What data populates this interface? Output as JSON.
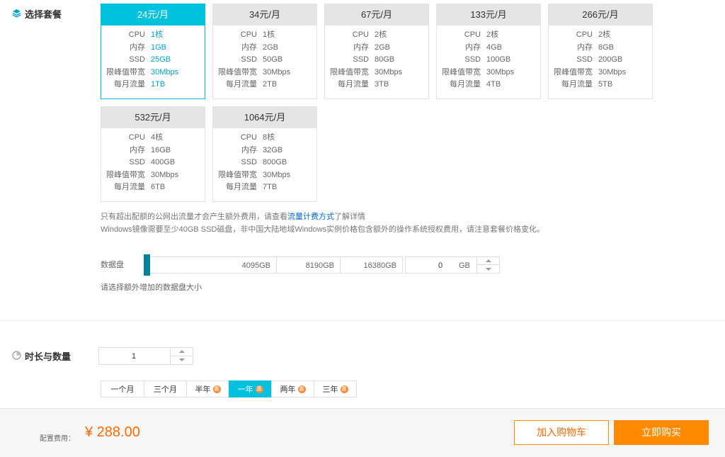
{
  "package_section": {
    "title": "选择套餐",
    "icon": "layers-icon"
  },
  "plans": [
    {
      "price": "24元/月",
      "selected": true,
      "rows": [
        [
          "CPU",
          "1核"
        ],
        [
          "内存",
          "1GB"
        ],
        [
          "SSD",
          "25GB"
        ],
        [
          "限峰值带宽",
          "30Mbps"
        ],
        [
          "每月流量",
          "1TB"
        ]
      ]
    },
    {
      "price": "34元/月",
      "selected": false,
      "rows": [
        [
          "CPU",
          "1核"
        ],
        [
          "内存",
          "2GB"
        ],
        [
          "SSD",
          "50GB"
        ],
        [
          "限峰值带宽",
          "30Mbps"
        ],
        [
          "每月流量",
          "2TB"
        ]
      ]
    },
    {
      "price": "67元/月",
      "selected": false,
      "rows": [
        [
          "CPU",
          "2核"
        ],
        [
          "内存",
          "2GB"
        ],
        [
          "SSD",
          "80GB"
        ],
        [
          "限峰值带宽",
          "30Mbps"
        ],
        [
          "每月流量",
          "3TB"
        ]
      ]
    },
    {
      "price": "133元/月",
      "selected": false,
      "rows": [
        [
          "CPU",
          "2核"
        ],
        [
          "内存",
          "4GB"
        ],
        [
          "SSD",
          "100GB"
        ],
        [
          "限峰值带宽",
          "30Mbps"
        ],
        [
          "每月流量",
          "4TB"
        ]
      ]
    },
    {
      "price": "266元/月",
      "selected": false,
      "rows": [
        [
          "CPU",
          "2核"
        ],
        [
          "内存",
          "8GB"
        ],
        [
          "SSD",
          "200GB"
        ],
        [
          "限峰值带宽",
          "30Mbps"
        ],
        [
          "每月流量",
          "5TB"
        ]
      ]
    },
    {
      "price": "532元/月",
      "selected": false,
      "rows": [
        [
          "CPU",
          "4核"
        ],
        [
          "内存",
          "16GB"
        ],
        [
          "SSD",
          "400GB"
        ],
        [
          "限峰值带宽",
          "30Mbps"
        ],
        [
          "每月流量",
          "6TB"
        ]
      ]
    },
    {
      "price": "1064元/月",
      "selected": false,
      "rows": [
        [
          "CPU",
          "8核"
        ],
        [
          "内存",
          "32GB"
        ],
        [
          "SSD",
          "800GB"
        ],
        [
          "限峰值带宽",
          "30Mbps"
        ],
        [
          "每月流量",
          "7TB"
        ]
      ]
    }
  ],
  "notes": {
    "line1_pre": "只有超出配额的公网出流量才会产生额外费用，请查看",
    "line1_link": "流量计费方式",
    "line1_post": "了解详情",
    "line2": "Windows镜像需要至少40GB SSD磁盘，非中国大陆地域Windows实例价格包含额外的操作系统授权费用，请注意套餐价格变化。"
  },
  "data_disk": {
    "label": "数据盘",
    "ticks": [
      "4095GB",
      "8190GB",
      "16380GB"
    ],
    "value": "0",
    "unit": "GB",
    "hint": "请选择额外增加的数据盘大小"
  },
  "duration_section": {
    "title": "时长与数量",
    "icon": "pie-clock-icon",
    "quantity": "1",
    "periods": [
      {
        "label": "一个月",
        "discount": false,
        "selected": false
      },
      {
        "label": "三个月",
        "discount": false,
        "selected": false
      },
      {
        "label": "半年",
        "discount": true,
        "selected": false
      },
      {
        "label": "一年",
        "discount": true,
        "selected": true
      },
      {
        "label": "两年",
        "discount": true,
        "selected": false
      },
      {
        "label": "三年",
        "discount": true,
        "selected": false
      }
    ],
    "discount_badge": "惠"
  },
  "footer": {
    "fee_label": "配置费用：",
    "fee_amount": "¥ 288.00",
    "cart_button": "加入购物车",
    "buy_button": "立即购买"
  },
  "colors": {
    "accent": "#00c1de",
    "orange": "#ff8a00",
    "price": "#ff6a00"
  }
}
